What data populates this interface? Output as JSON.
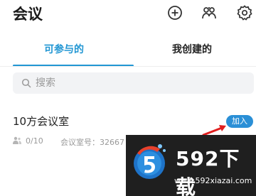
{
  "header": {
    "title": "会议"
  },
  "icons": {
    "add": "add-circle-icon",
    "contacts": "contacts-icon",
    "settings": "settings-gear-icon"
  },
  "tabs": [
    {
      "label": "可参与的",
      "active": true
    },
    {
      "label": "我创建的",
      "active": false
    }
  ],
  "search": {
    "placeholder": "搜索",
    "value": ""
  },
  "rooms": [
    {
      "name": "10方会议室",
      "members": "0/10",
      "room_id_label": "会议室号：32667",
      "join_label": "加入"
    }
  ],
  "watermark": {
    "brand": "592下载",
    "url": "www.592xiazai.com"
  },
  "colors": {
    "accent": "#2196d3",
    "join_button": "#2a8fd6",
    "arrow": "#e01e1e",
    "watermark_bg": "#1f1f1f"
  }
}
